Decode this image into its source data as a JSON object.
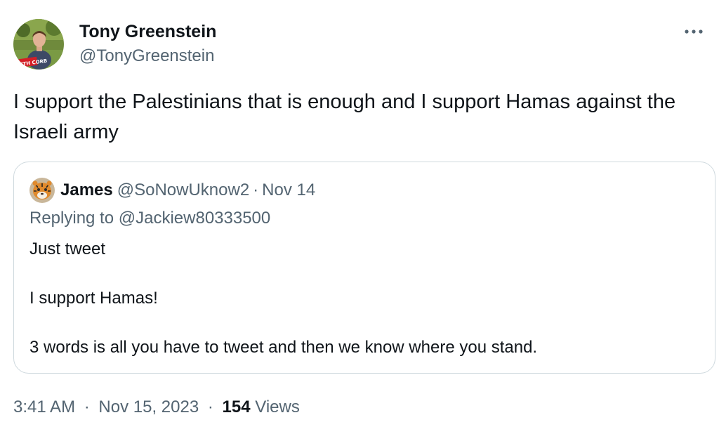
{
  "tweet": {
    "author": {
      "name": "Tony Greenstein",
      "handle": "@TonyGreenstein",
      "avatar_badge": "WITH CORB"
    },
    "more_icon": "more-horizontal-icon",
    "text": "I support the Palestinians that is enough and I support Hamas against the Israeli army",
    "quoted": {
      "author_name": "James",
      "author_handle": "@SoNowUknow2",
      "separator": "·",
      "date": "Nov 14",
      "avatar_icon": "tiger-avatar",
      "replying_prefix": "Replying to",
      "replying_handle": "@Jackiew80333500",
      "paragraphs": [
        "Just tweet",
        "I support Hamas!",
        "3 words is all you have to tweet and then we know where you stand."
      ]
    },
    "meta": {
      "time": "3:41 AM",
      "separator": "·",
      "date": "Nov 15, 2023",
      "views_count": "154",
      "views_label": "Views"
    }
  }
}
